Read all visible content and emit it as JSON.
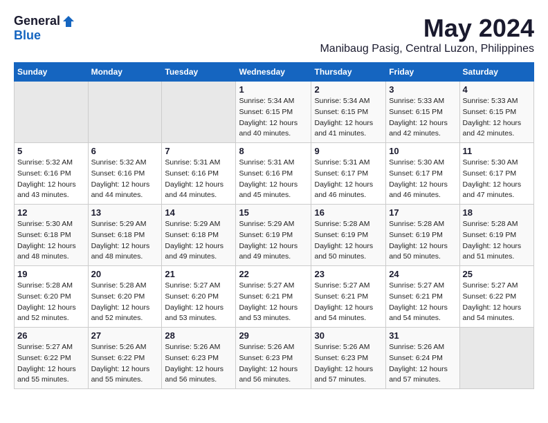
{
  "logo": {
    "general": "General",
    "blue": "Blue"
  },
  "title": "May 2024",
  "location": "Manibaug Pasig, Central Luzon, Philippines",
  "weekdays": [
    "Sunday",
    "Monday",
    "Tuesday",
    "Wednesday",
    "Thursday",
    "Friday",
    "Saturday"
  ],
  "weeks": [
    [
      null,
      null,
      null,
      {
        "day": "1",
        "sunrise": "Sunrise: 5:34 AM",
        "sunset": "Sunset: 6:15 PM",
        "daylight": "Daylight: 12 hours and 40 minutes."
      },
      {
        "day": "2",
        "sunrise": "Sunrise: 5:34 AM",
        "sunset": "Sunset: 6:15 PM",
        "daylight": "Daylight: 12 hours and 41 minutes."
      },
      {
        "day": "3",
        "sunrise": "Sunrise: 5:33 AM",
        "sunset": "Sunset: 6:15 PM",
        "daylight": "Daylight: 12 hours and 42 minutes."
      },
      {
        "day": "4",
        "sunrise": "Sunrise: 5:33 AM",
        "sunset": "Sunset: 6:15 PM",
        "daylight": "Daylight: 12 hours and 42 minutes."
      }
    ],
    [
      {
        "day": "5",
        "sunrise": "Sunrise: 5:32 AM",
        "sunset": "Sunset: 6:16 PM",
        "daylight": "Daylight: 12 hours and 43 minutes."
      },
      {
        "day": "6",
        "sunrise": "Sunrise: 5:32 AM",
        "sunset": "Sunset: 6:16 PM",
        "daylight": "Daylight: 12 hours and 44 minutes."
      },
      {
        "day": "7",
        "sunrise": "Sunrise: 5:31 AM",
        "sunset": "Sunset: 6:16 PM",
        "daylight": "Daylight: 12 hours and 44 minutes."
      },
      {
        "day": "8",
        "sunrise": "Sunrise: 5:31 AM",
        "sunset": "Sunset: 6:16 PM",
        "daylight": "Daylight: 12 hours and 45 minutes."
      },
      {
        "day": "9",
        "sunrise": "Sunrise: 5:31 AM",
        "sunset": "Sunset: 6:17 PM",
        "daylight": "Daylight: 12 hours and 46 minutes."
      },
      {
        "day": "10",
        "sunrise": "Sunrise: 5:30 AM",
        "sunset": "Sunset: 6:17 PM",
        "daylight": "Daylight: 12 hours and 46 minutes."
      },
      {
        "day": "11",
        "sunrise": "Sunrise: 5:30 AM",
        "sunset": "Sunset: 6:17 PM",
        "daylight": "Daylight: 12 hours and 47 minutes."
      }
    ],
    [
      {
        "day": "12",
        "sunrise": "Sunrise: 5:30 AM",
        "sunset": "Sunset: 6:18 PM",
        "daylight": "Daylight: 12 hours and 48 minutes."
      },
      {
        "day": "13",
        "sunrise": "Sunrise: 5:29 AM",
        "sunset": "Sunset: 6:18 PM",
        "daylight": "Daylight: 12 hours and 48 minutes."
      },
      {
        "day": "14",
        "sunrise": "Sunrise: 5:29 AM",
        "sunset": "Sunset: 6:18 PM",
        "daylight": "Daylight: 12 hours and 49 minutes."
      },
      {
        "day": "15",
        "sunrise": "Sunrise: 5:29 AM",
        "sunset": "Sunset: 6:19 PM",
        "daylight": "Daylight: 12 hours and 49 minutes."
      },
      {
        "day": "16",
        "sunrise": "Sunrise: 5:28 AM",
        "sunset": "Sunset: 6:19 PM",
        "daylight": "Daylight: 12 hours and 50 minutes."
      },
      {
        "day": "17",
        "sunrise": "Sunrise: 5:28 AM",
        "sunset": "Sunset: 6:19 PM",
        "daylight": "Daylight: 12 hours and 50 minutes."
      },
      {
        "day": "18",
        "sunrise": "Sunrise: 5:28 AM",
        "sunset": "Sunset: 6:19 PM",
        "daylight": "Daylight: 12 hours and 51 minutes."
      }
    ],
    [
      {
        "day": "19",
        "sunrise": "Sunrise: 5:28 AM",
        "sunset": "Sunset: 6:20 PM",
        "daylight": "Daylight: 12 hours and 52 minutes."
      },
      {
        "day": "20",
        "sunrise": "Sunrise: 5:28 AM",
        "sunset": "Sunset: 6:20 PM",
        "daylight": "Daylight: 12 hours and 52 minutes."
      },
      {
        "day": "21",
        "sunrise": "Sunrise: 5:27 AM",
        "sunset": "Sunset: 6:20 PM",
        "daylight": "Daylight: 12 hours and 53 minutes."
      },
      {
        "day": "22",
        "sunrise": "Sunrise: 5:27 AM",
        "sunset": "Sunset: 6:21 PM",
        "daylight": "Daylight: 12 hours and 53 minutes."
      },
      {
        "day": "23",
        "sunrise": "Sunrise: 5:27 AM",
        "sunset": "Sunset: 6:21 PM",
        "daylight": "Daylight: 12 hours and 54 minutes."
      },
      {
        "day": "24",
        "sunrise": "Sunrise: 5:27 AM",
        "sunset": "Sunset: 6:21 PM",
        "daylight": "Daylight: 12 hours and 54 minutes."
      },
      {
        "day": "25",
        "sunrise": "Sunrise: 5:27 AM",
        "sunset": "Sunset: 6:22 PM",
        "daylight": "Daylight: 12 hours and 54 minutes."
      }
    ],
    [
      {
        "day": "26",
        "sunrise": "Sunrise: 5:27 AM",
        "sunset": "Sunset: 6:22 PM",
        "daylight": "Daylight: 12 hours and 55 minutes."
      },
      {
        "day": "27",
        "sunrise": "Sunrise: 5:26 AM",
        "sunset": "Sunset: 6:22 PM",
        "daylight": "Daylight: 12 hours and 55 minutes."
      },
      {
        "day": "28",
        "sunrise": "Sunrise: 5:26 AM",
        "sunset": "Sunset: 6:23 PM",
        "daylight": "Daylight: 12 hours and 56 minutes."
      },
      {
        "day": "29",
        "sunrise": "Sunrise: 5:26 AM",
        "sunset": "Sunset: 6:23 PM",
        "daylight": "Daylight: 12 hours and 56 minutes."
      },
      {
        "day": "30",
        "sunrise": "Sunrise: 5:26 AM",
        "sunset": "Sunset: 6:23 PM",
        "daylight": "Daylight: 12 hours and 57 minutes."
      },
      {
        "day": "31",
        "sunrise": "Sunrise: 5:26 AM",
        "sunset": "Sunset: 6:24 PM",
        "daylight": "Daylight: 12 hours and 57 minutes."
      },
      null
    ]
  ]
}
